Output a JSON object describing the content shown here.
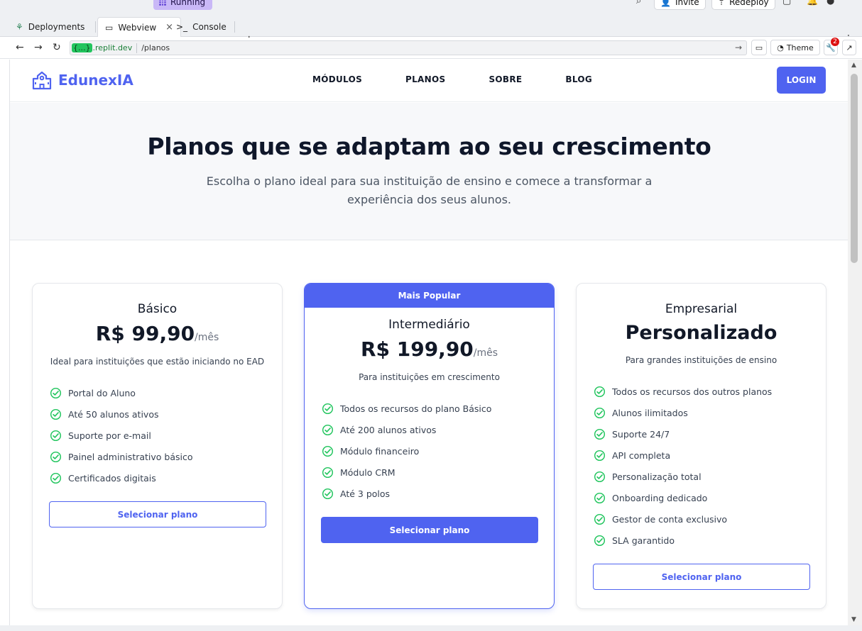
{
  "chrome": {
    "status": "Running",
    "invite": "Invite",
    "redeploy": "Redeploy",
    "tabs": [
      {
        "label": "Deployments"
      },
      {
        "label": "Webview"
      },
      {
        "label": "Console"
      }
    ],
    "url_pill": "{...}",
    "url_host": ".replit.dev",
    "url_path": "/planos",
    "theme_label": "Theme",
    "notif_count": "2"
  },
  "site": {
    "brand": "EdunexIA",
    "nav": [
      "MÓDULOS",
      "PLANOS",
      "SOBRE",
      "BLOG"
    ],
    "login": "LOGIN"
  },
  "hero": {
    "title": "Planos que se adaptam ao seu crescimento",
    "subtitle": "Escolha o plano ideal para sua instituição de ensino e comece a transformar a experiência dos seus alunos."
  },
  "plans": [
    {
      "name": "Básico",
      "price": "R$ 99,90",
      "period": "/mês",
      "description": "Ideal para instituições que estão iniciando no EAD",
      "features": [
        "Portal do Aluno",
        "Até 50 alunos ativos",
        "Suporte por e-mail",
        "Painel administrativo básico",
        "Certificados digitais"
      ],
      "button": "Selecionar plano"
    },
    {
      "badge": "Mais Popular",
      "name": "Intermediário",
      "price": "R$ 199,90",
      "period": "/mês",
      "description": "Para instituições em crescimento",
      "features": [
        "Todos os recursos do plano Básico",
        "Até 200 alunos ativos",
        "Módulo financeiro",
        "Módulo CRM",
        "Até 3 polos"
      ],
      "button": "Selecionar plano"
    },
    {
      "name": "Empresarial",
      "price": "Personalizado",
      "description": "Para grandes instituições de ensino",
      "features": [
        "Todos os recursos dos outros planos",
        "Alunos ilimitados",
        "Suporte 24/7",
        "API completa",
        "Personalização total",
        "Onboarding dedicado",
        "Gestor de conta exclusivo",
        "SLA garantido"
      ],
      "button": "Selecionar plano"
    }
  ],
  "colors": {
    "accent": "#4f63f0",
    "check": "#22c55e"
  }
}
